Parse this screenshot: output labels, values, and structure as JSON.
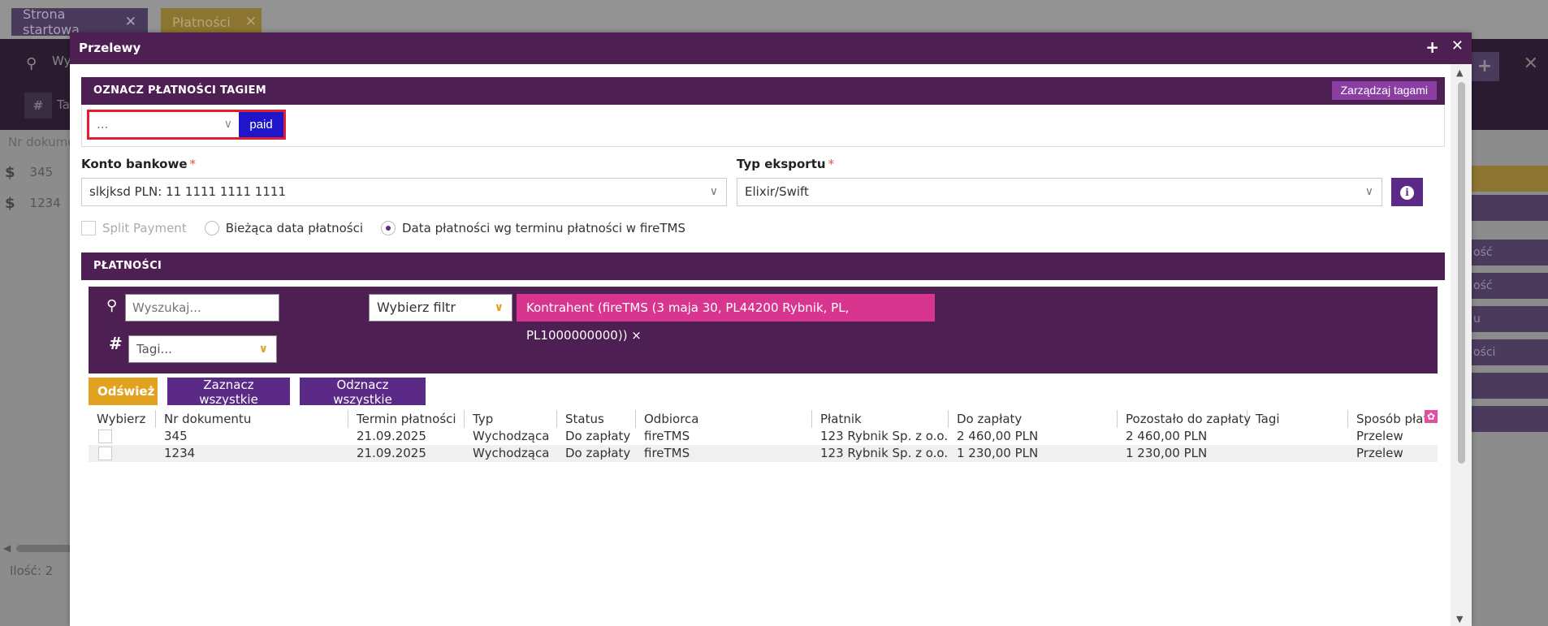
{
  "background": {
    "tabs": [
      {
        "label": "Strona startowa"
      },
      {
        "label": "Płatności"
      }
    ],
    "search_placeholder": "Wy",
    "tags_label": "Ta",
    "column_nr": "Nr dokume",
    "rows": [
      {
        "symbol": "$",
        "nr": "345"
      },
      {
        "symbol": "$",
        "nr": "1234"
      }
    ],
    "count": "Ilość: 2",
    "side_items": [
      "ość",
      "ość",
      "u",
      "ości"
    ]
  },
  "modal": {
    "title": "Przelewy",
    "tag_section": {
      "title": "OZNACZ PŁATNOŚCI TAGIEM",
      "manage_button": "Zarządzaj tagami",
      "select_value": "...",
      "paid_button": "paid"
    },
    "bank_account": {
      "label": "Konto bankowe",
      "required": "*",
      "value": "slkjksd PLN: 11 1111 1111 1111"
    },
    "export_type": {
      "label": "Typ eksportu",
      "required": "*",
      "value": "Elixir/Swift"
    },
    "options": {
      "split_payment": "Split Payment",
      "current_date": "Bieżąca data płatności",
      "term_date": "Data płatności wg terminu płatności w fireTMS",
      "selected": "term_date"
    },
    "payments": {
      "title": "PŁATNOŚCI",
      "search_placeholder": "Wyszukaj...",
      "filter_select": "Wybierz filtr",
      "filter_chip": "Kontrahent (fireTMS (3 maja 30, PL44200 Rybnik, PL, PL1000000000)) ×",
      "tags_select": "Tagi...",
      "buttons": {
        "refresh": "Odśwież",
        "select_all": "Zaznacz wszystkie",
        "deselect_all": "Odznacz wszystkie"
      },
      "columns": [
        "Wybierz",
        "Nr dokumentu",
        "Termin płatności",
        "Typ",
        "Status",
        "Odbiorca",
        "Płatnik",
        "Do zapłaty",
        "Pozostało do zapłaty",
        "Tagi",
        "Sposób płat"
      ],
      "rows": [
        {
          "nr": "345",
          "termin": "21.09.2025",
          "typ": "Wychodząca",
          "status": "Do zapłaty",
          "odbiorca": "fireTMS",
          "platnik": "123 Rybnik Sp. z o.o.",
          "do_zaplaty": "2 460,00 PLN",
          "pozostalo": "2 460,00 PLN",
          "tagi": "",
          "sposob": "Przelew"
        },
        {
          "nr": "1234",
          "termin": "21.09.2025",
          "typ": "Wychodząca",
          "status": "Do zapłaty",
          "odbiorca": "fireTMS",
          "platnik": "123 Rybnik Sp. z o.o.",
          "do_zaplaty": "1 230,00 PLN",
          "pozostalo": "1 230,00 PLN",
          "tagi": "",
          "sposob": "Przelew"
        }
      ]
    }
  },
  "colors": {
    "header_purple": "#4e1f52",
    "button_purple": "#5b2a86",
    "accent_gold": "#e2a21f",
    "chip_pink": "#d8358f",
    "paid_blue": "#2016c9",
    "highlight_red": "#e02030"
  }
}
